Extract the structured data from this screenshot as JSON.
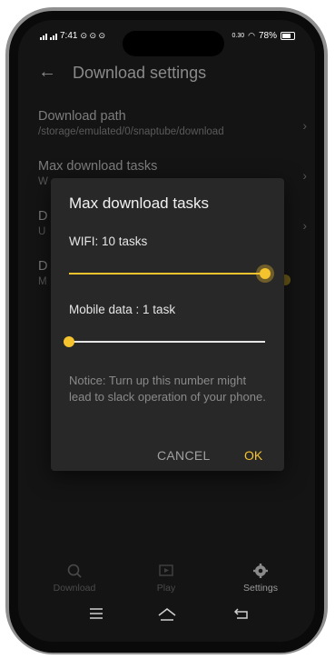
{
  "status_bar": {
    "time": "7:41",
    "left_icons": [
      "signal-icon",
      "signal-icon",
      "notification-icon",
      "notification-icon",
      "notification-icon"
    ],
    "right_text": "0.30",
    "battery": "78%"
  },
  "header": {
    "title": "Download settings",
    "back_icon": "arrow-left-icon"
  },
  "settings": [
    {
      "title": "Download path",
      "subtitle": "/storage/emulated/0/snaptube/download"
    },
    {
      "title": "Max download tasks",
      "subtitle": "W"
    },
    {
      "title": "D",
      "subtitle": "U"
    },
    {
      "title": "D",
      "subtitle": "M"
    }
  ],
  "dialog": {
    "title": "Max download tasks",
    "wifi_label": "WIFI:  10 tasks",
    "wifi_level": 1.0,
    "mobile_label": "Mobile data : 1 task",
    "mobile_level": 0.0,
    "notice": "Notice: Turn up this number might lead to slack operation of your phone.",
    "cancel": "CANCEL",
    "ok": "OK",
    "accent_color": "#f5c32e"
  },
  "bottom_nav": [
    {
      "label": "Download",
      "icon": "search-icon"
    },
    {
      "label": "Play",
      "icon": "play-icon"
    },
    {
      "label": "Settings",
      "icon": "gear-icon",
      "active": true
    }
  ],
  "system_nav": [
    "menu-icon",
    "home-icon",
    "back-icon"
  ]
}
